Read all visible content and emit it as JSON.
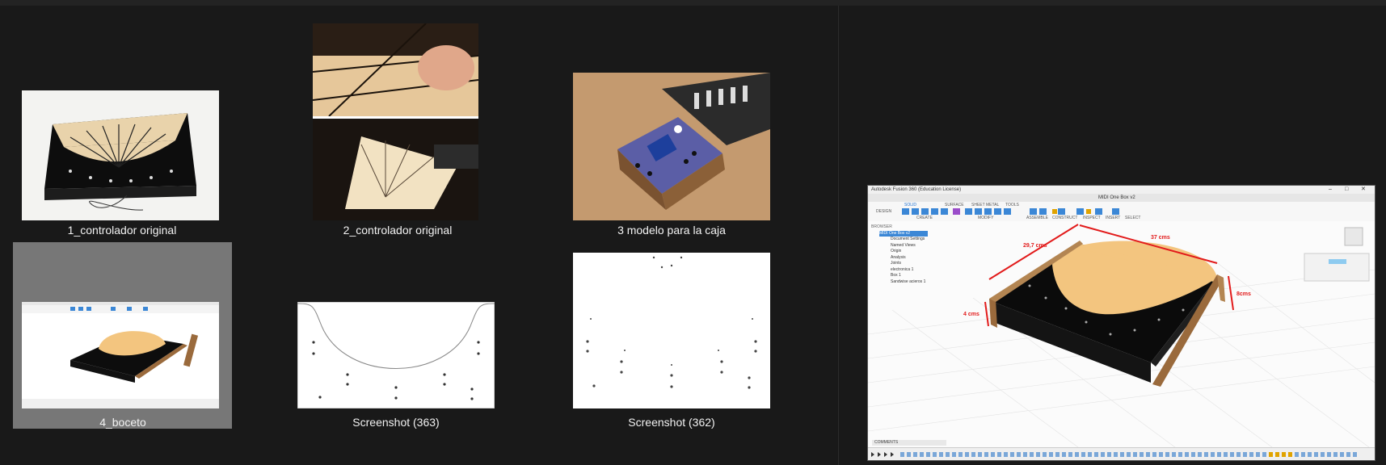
{
  "gallery": {
    "items": [
      {
        "caption": "1_controlador original",
        "selected": false
      },
      {
        "caption": "2_controlador original",
        "selected": false
      },
      {
        "caption": "3 modelo para la caja",
        "selected": false
      },
      {
        "caption": "4_boceto",
        "selected": true
      },
      {
        "caption": "Screenshot (363)",
        "selected": false
      },
      {
        "caption": "Screenshot (362)",
        "selected": false
      }
    ]
  },
  "preview": {
    "app_title": "Autodesk Fusion 360 (Education License)",
    "document_tab": "MIDI One Box v2",
    "workspace_button": "DESIGN",
    "toolbar_tabs": [
      "SOLID",
      "SURFACE",
      "SHEET METAL",
      "TOOLS"
    ],
    "toolbar_groups": [
      "CREATE",
      "MODIFY",
      "ASSEMBLE",
      "CONSTRUCT",
      "INSPECT",
      "INSERT",
      "SELECT"
    ],
    "browser_title": "BROWSER",
    "browser_items": [
      "MIDI One Box v2",
      "Document Settings",
      "Named Views",
      "Origin",
      "Analysis",
      "Joints",
      "electronica 1",
      "Box 1",
      "Sandwise acieros 1"
    ],
    "comments_label": "COMMENTS",
    "dimensions": [
      "37 cms",
      "29,7 cms",
      "4 cms",
      "8cms"
    ],
    "colors": {
      "lid": "#f3c57f",
      "panel": "#0b0b0b",
      "wood": "#9a6a3c",
      "dimension_line": "#e21b1b"
    }
  }
}
